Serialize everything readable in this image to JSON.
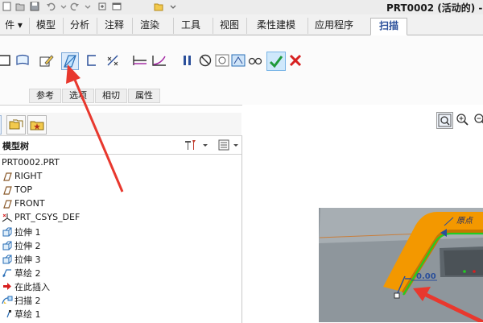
{
  "window": {
    "title": "PRT0002 (活动的) -"
  },
  "menu": {
    "file": "件",
    "tabs": [
      "模型",
      "分析",
      "注释",
      "渲染",
      "工具",
      "视图",
      "柔性建模",
      "应用程序"
    ],
    "active_tab": "扫描"
  },
  "ribbon": {
    "groups": [
      "参考",
      "选项",
      "相切",
      "属性"
    ]
  },
  "tree": {
    "title": "模型树",
    "items": [
      {
        "label": "PRT0002.PRT",
        "icon": "part-icon"
      },
      {
        "label": "RIGHT",
        "icon": "datum-plane-icon"
      },
      {
        "label": "TOP",
        "icon": "datum-plane-icon"
      },
      {
        "label": "FRONT",
        "icon": "datum-plane-icon"
      },
      {
        "label": "PRT_CSYS_DEF",
        "icon": "csys-icon"
      },
      {
        "label": "拉伸 1",
        "icon": "extrude-icon"
      },
      {
        "label": "拉伸 2",
        "icon": "extrude-icon"
      },
      {
        "label": "拉伸 3",
        "icon": "extrude-icon"
      },
      {
        "label": "草绘 2",
        "icon": "sketch-icon"
      },
      {
        "label": "在此插入",
        "icon": "insert-here-icon"
      },
      {
        "label": "扫描 2",
        "icon": "sweep-icon"
      },
      {
        "label": "草绘 1",
        "icon": "sketch-icon"
      }
    ]
  },
  "viewport": {
    "origin_label": "原点",
    "dimension_value": "0.00"
  },
  "colors": {
    "sweep": "#f39800",
    "trajectory": "#22cc22",
    "annotation_arrow": "#e8382e",
    "model_gray": "#8e969c",
    "accent_blue": "#2a4f9a"
  }
}
